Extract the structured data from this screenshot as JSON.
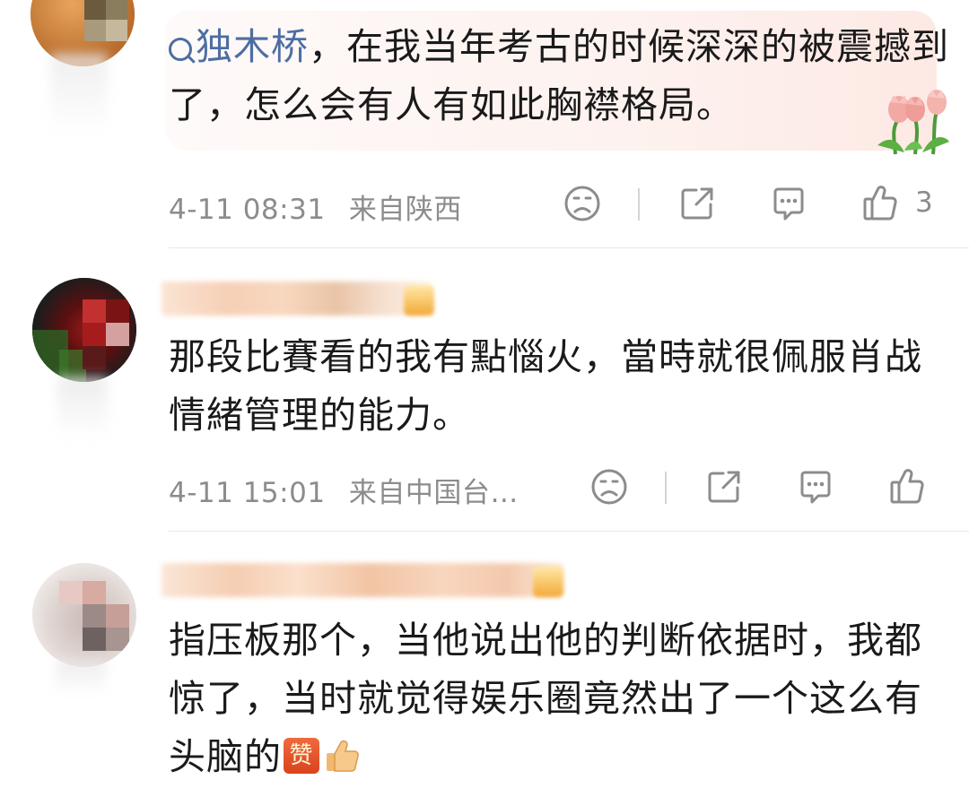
{
  "comments": [
    {
      "mention": "独木桥",
      "text": "，在我当年考古的时候深深的被震撼到了，怎么会有人有如此胸襟格局。",
      "time": "4-11 08:31",
      "location": "来自陕西",
      "likes": "3"
    },
    {
      "text": "那段比賽看的我有點惱火，當時就很佩服肖战情緒管理的能力。",
      "time": "4-11 15:01",
      "location": "来自中国台…",
      "likes": ""
    },
    {
      "text": "指压板那个，当他说出他的判断依据时，我都惊了，当时就觉得娱乐圈竟然出了一个这么有头脑的",
      "emoji_badge": "赞",
      "time": "",
      "location": "",
      "likes": ""
    }
  ],
  "icons": {
    "react": "sad-face-icon",
    "share": "share-icon",
    "reply": "comment-icon",
    "like": "thumbs-up-icon",
    "decoration": "tulip-flower-icon",
    "thumb_emoji": "thumbs-up-emoji-icon"
  },
  "colors": {
    "mention": "#4d6ea3",
    "meta_text": "#8c8c8c",
    "bubble": "#fdf2ef",
    "badge": "#e4572e"
  }
}
